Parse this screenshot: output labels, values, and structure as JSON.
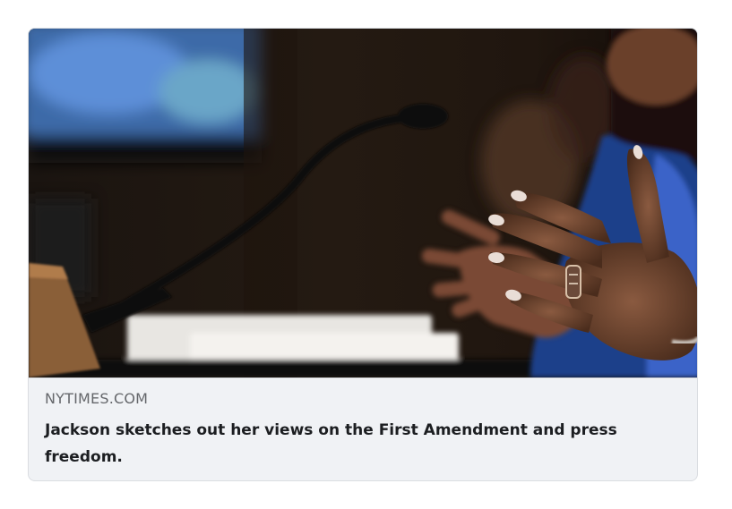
{
  "link_preview": {
    "source": "NYTIMES.COM",
    "headline": "Jackson sketches out her views on the First Amendment and press freedom."
  }
}
